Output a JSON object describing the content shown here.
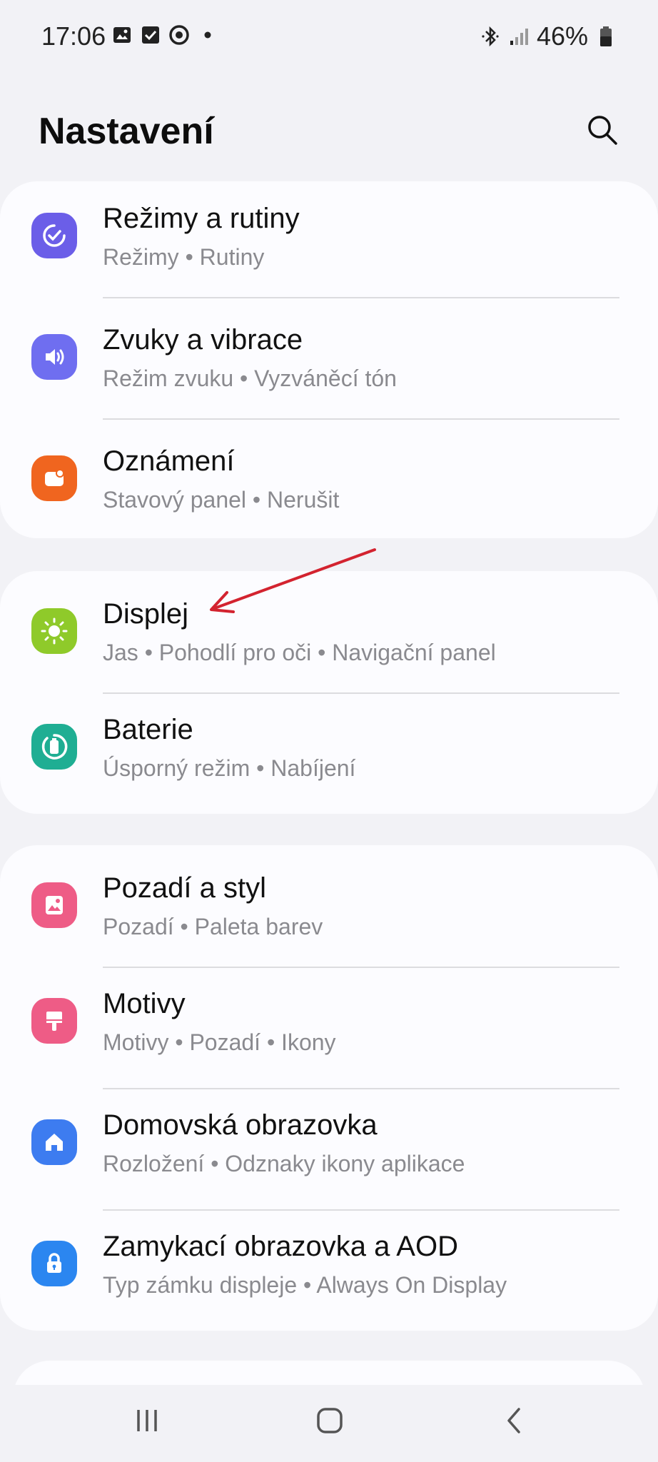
{
  "status_bar": {
    "time": "17:06",
    "battery_pct": "46%",
    "icons_left": [
      "gallery-icon",
      "checkbox-icon",
      "smart-view-icon",
      "dot-icon"
    ],
    "icons_right": [
      "bluetooth-icon",
      "signal-icon",
      "battery-icon"
    ]
  },
  "header": {
    "title": "Nastavení",
    "search_icon": "search-icon"
  },
  "settings_groups": [
    {
      "items": [
        {
          "title": "Režimy a rutiny",
          "subtitle": "Režimy  •  Rutiny",
          "icon": "modes-routines-icon",
          "color": "#6b5ee8"
        },
        {
          "title": "Zvuky a vibrace",
          "subtitle": "Režim zvuku  •  Vyzváněcí tón",
          "icon": "sound-icon",
          "color": "#6f6ef0"
        },
        {
          "title": "Oznámení",
          "subtitle": "Stavový panel  •  Nerušit",
          "icon": "notifications-icon",
          "color": "#f0651f"
        }
      ]
    },
    {
      "items": [
        {
          "title": "Displej",
          "subtitle": "Jas  •  Pohodlí pro oči  •  Navigační panel",
          "icon": "display-icon",
          "color": "#8fca2a"
        },
        {
          "title": "Baterie",
          "subtitle": "Úsporný režim  •  Nabíjení",
          "icon": "battery-care-icon",
          "color": "#1fae93"
        }
      ]
    },
    {
      "items": [
        {
          "title": "Pozadí a styl",
          "subtitle": "Pozadí  •  Paleta barev",
          "icon": "wallpaper-icon",
          "color": "#ee5c86"
        },
        {
          "title": "Motivy",
          "subtitle": "Motivy  •  Pozadí  •  Ikony",
          "icon": "themes-icon",
          "color": "#ee5c86"
        },
        {
          "title": "Domovská obrazovka",
          "subtitle": "Rozložení  •  Odznaky ikony aplikace",
          "icon": "home-screen-icon",
          "color": "#3d7cf0"
        },
        {
          "title": "Zamykací obrazovka a AOD",
          "subtitle": "Typ zámku displeje  •  Always On Display",
          "icon": "lock-icon",
          "color": "#2b86f0"
        }
      ]
    }
  ],
  "annotation": {
    "type": "arrow",
    "color": "#d3232f",
    "points_to": "Displej"
  },
  "nav_bar": {
    "icons": [
      "recents-icon",
      "home-icon",
      "back-icon"
    ]
  },
  "colors": {
    "background": "#f2f2f6",
    "card": "#fcfcff",
    "subtitle": "#8a8a8f"
  }
}
